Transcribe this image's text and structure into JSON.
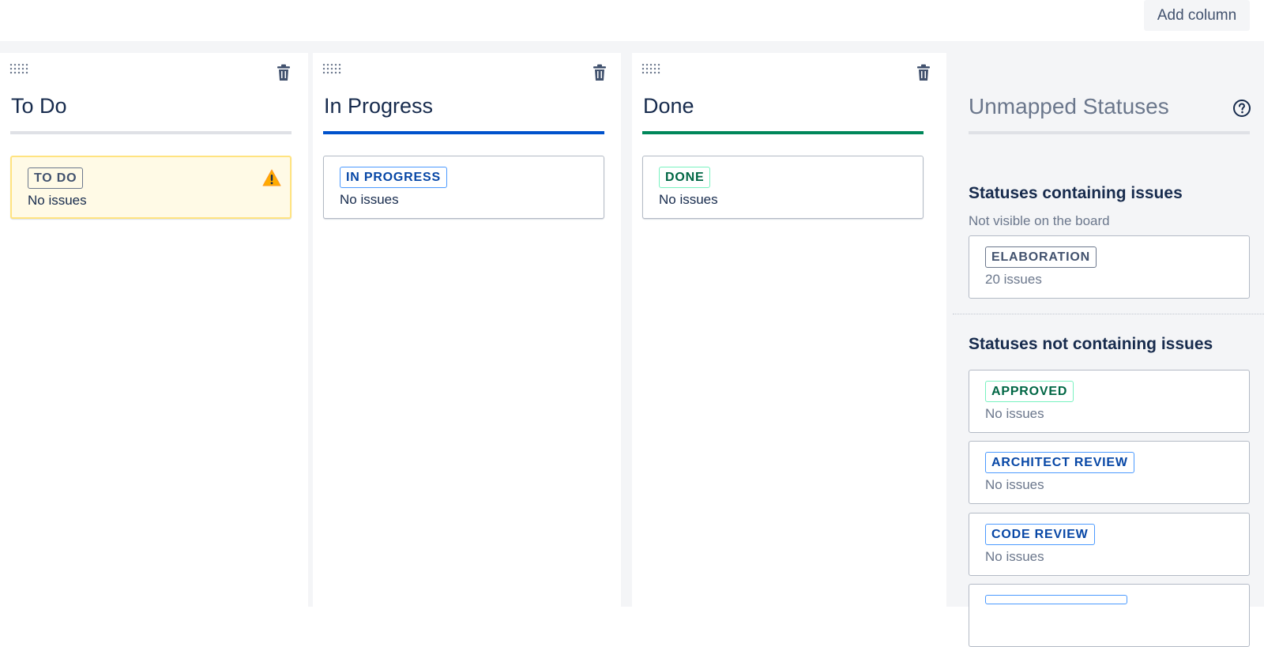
{
  "toolbar": {
    "add_column_label": "Add column"
  },
  "columns": [
    {
      "title": "To Do",
      "bar_color": "#dfe1e6",
      "status": "TO DO",
      "count": "No issues",
      "warning": true
    },
    {
      "title": "In Progress",
      "bar_color": "#0052cc",
      "status": "IN PROGRESS",
      "count": "No issues",
      "warning": false
    },
    {
      "title": "Done",
      "bar_color": "#00875a",
      "status": "DONE",
      "count": "No issues",
      "warning": false
    }
  ],
  "unmapped": {
    "title": "Unmapped Statuses",
    "containing": {
      "title": "Statuses containing issues",
      "subtitle": "Not visible on the board",
      "items": [
        {
          "status": "ELABORATION",
          "count": "20 issues"
        }
      ]
    },
    "not_containing": {
      "title": "Statuses not containing issues",
      "items": [
        {
          "status": "APPROVED",
          "count": "No issues"
        },
        {
          "status": "ARCHITECT REVIEW",
          "count": "No issues"
        },
        {
          "status": "CODE REVIEW",
          "count": "No issues"
        }
      ]
    }
  },
  "icons": {
    "drag": "drag-handle-icon",
    "trash": "trash-icon",
    "warning": "warning-icon",
    "help": "help-icon"
  }
}
